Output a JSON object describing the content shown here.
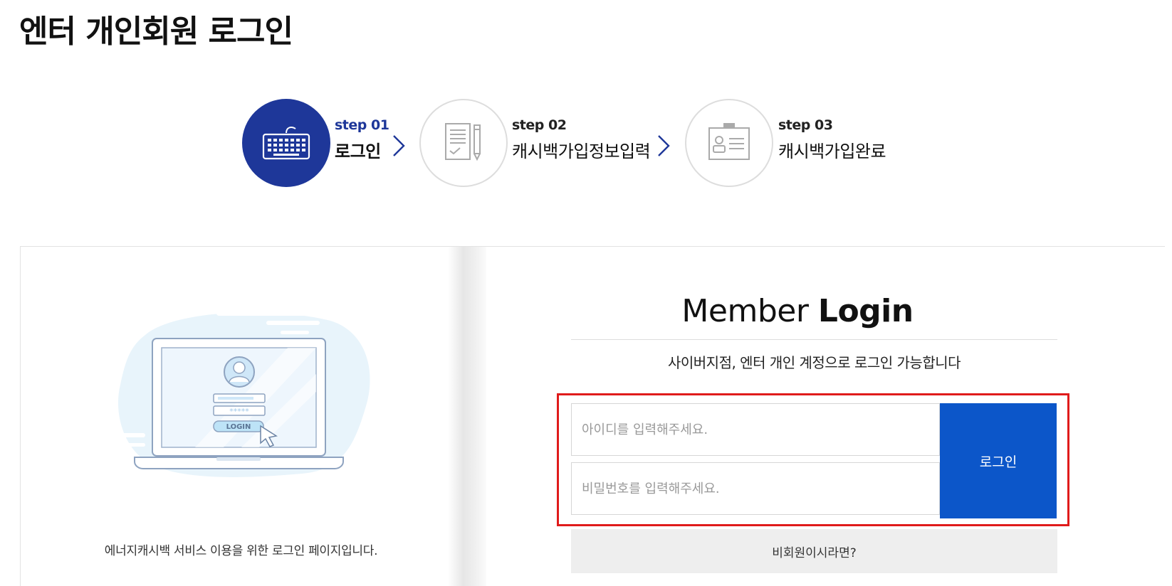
{
  "page": {
    "title": "엔터 개인회원 로그인"
  },
  "steps": [
    {
      "num": "step 01",
      "label": "로그인",
      "icon": "keyboard-icon",
      "active": true
    },
    {
      "num": "step 02",
      "label": "캐시백가입정보입력",
      "icon": "document-pencil-icon",
      "active": false
    },
    {
      "num": "step 03",
      "label": "캐시백가입완료",
      "icon": "id-card-icon",
      "active": false
    }
  ],
  "left": {
    "caption": "에너지캐시백 서비스 이용을 위한 로그인 페이지입니다.",
    "illustration": {
      "button_text": "LOGIN",
      "password_mask": "*****"
    }
  },
  "login": {
    "title_light": "Member",
    "title_bold": "Login",
    "subtitle": "사이버지점, 엔터 개인 계정으로 로그인 가능합니다",
    "id_placeholder": "아이디를 입력해주세요.",
    "pw_placeholder": "비밀번호를 입력해주세요.",
    "button_label": "로그인",
    "nonmember_label": "비회원이시라면?"
  },
  "colors": {
    "accent": "#1e3799",
    "button": "#0c56c9",
    "highlight": "#e01b1b"
  }
}
